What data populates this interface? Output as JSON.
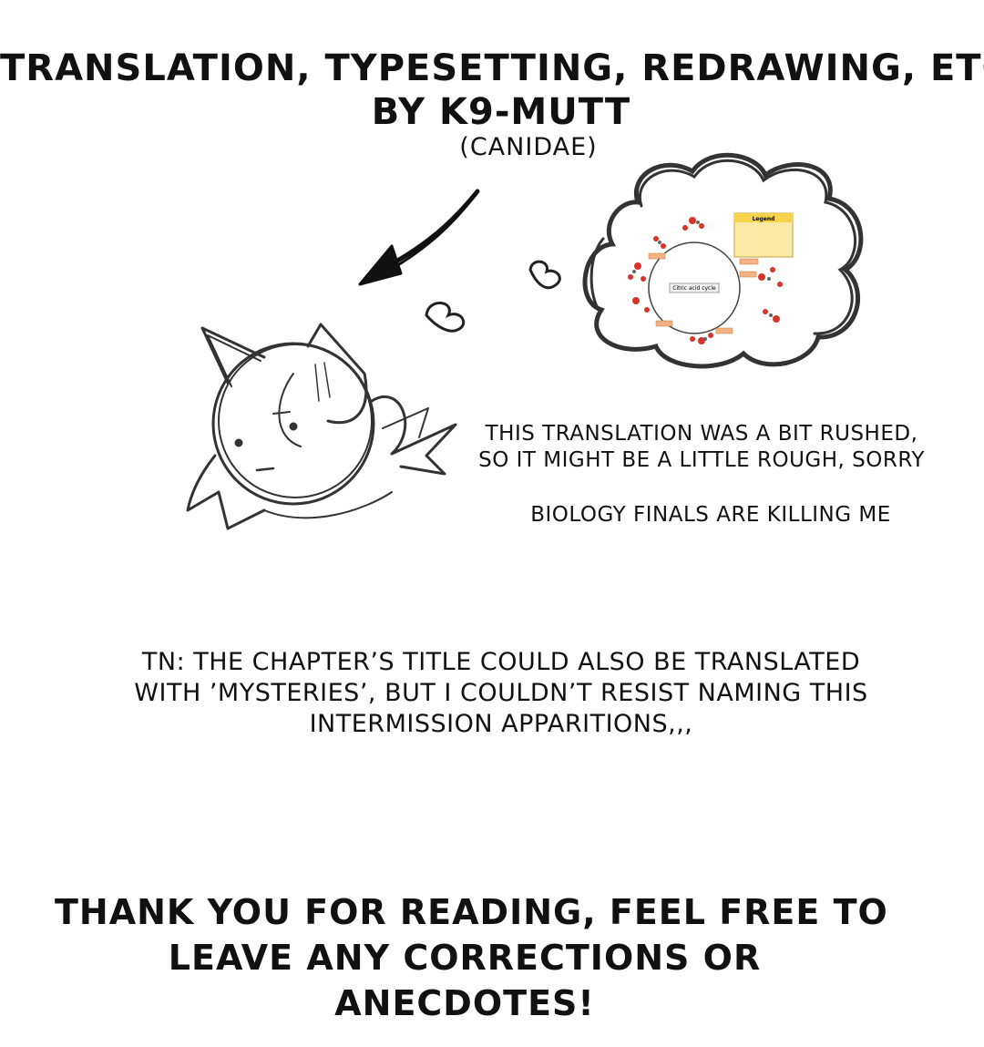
{
  "credits": {
    "line1": "TRANSLATION, TYPESETTING, REDRAWING, ETC.",
    "line2": "BY K9-MUTT",
    "line3": "(CANIDAE)"
  },
  "notes": {
    "rushed_line1": "THIS TRANSLATION WAS A BIT RUSHED,",
    "rushed_line2": "SO IT MIGHT BE A LITTLE ROUGH, SORRY",
    "finals": "BIOLOGY FINALS ARE KILLING ME"
  },
  "translator_note": {
    "line1": "TN: THE CHAPTER’S TITLE COULD ALSO BE TRANSLATED",
    "line2": "WITH ’MYSTERIES’, BUT I COULDN’T RESIST NAMING THIS",
    "line3": "INTERMISSION APPARITIONS,,,"
  },
  "thanks": {
    "line1": "THANK YOU FOR READING, FEEL FREE TO",
    "line2": "LEAVE ANY CORRECTIONS OR",
    "line3": "ANECDOTES!"
  },
  "thought_bubble": {
    "legend_title": "Legend",
    "cycle_title": "Citric acid cycle"
  },
  "colors": {
    "ink": "#111111",
    "sketch": "#333333",
    "legend_fill": "#f7d24a",
    "molecule_red": "#d8342c",
    "enzyme_label": "#c0504d"
  },
  "icons": {
    "arrow": "arrow-down-left-icon",
    "heart": "heart-icon"
  }
}
